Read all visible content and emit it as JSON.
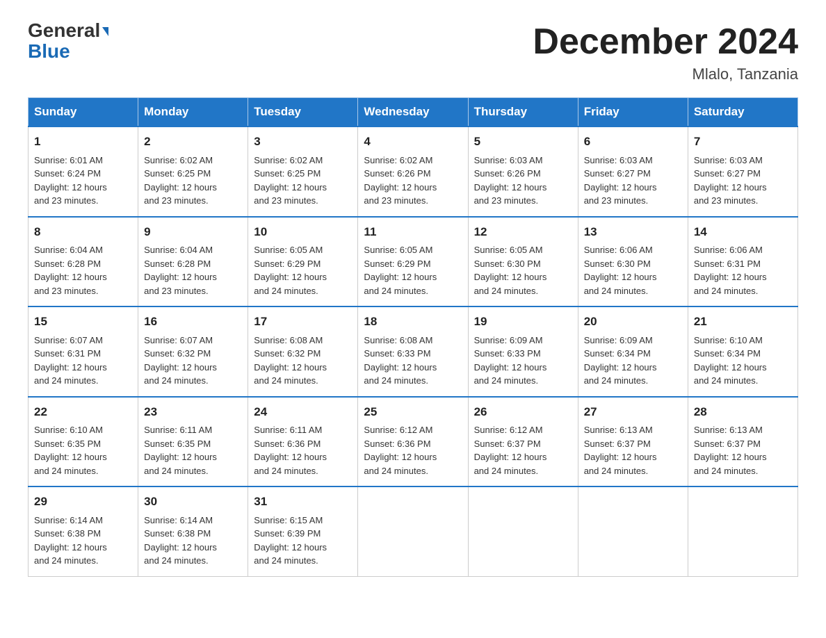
{
  "header": {
    "logo_line1": "General",
    "logo_line2": "Blue",
    "month_title": "December 2024",
    "location": "Mlalo, Tanzania"
  },
  "weekdays": [
    "Sunday",
    "Monday",
    "Tuesday",
    "Wednesday",
    "Thursday",
    "Friday",
    "Saturday"
  ],
  "weeks": [
    [
      {
        "day": "1",
        "sunrise": "6:01 AM",
        "sunset": "6:24 PM",
        "daylight": "12 hours and 23 minutes."
      },
      {
        "day": "2",
        "sunrise": "6:02 AM",
        "sunset": "6:25 PM",
        "daylight": "12 hours and 23 minutes."
      },
      {
        "day": "3",
        "sunrise": "6:02 AM",
        "sunset": "6:25 PM",
        "daylight": "12 hours and 23 minutes."
      },
      {
        "day": "4",
        "sunrise": "6:02 AM",
        "sunset": "6:26 PM",
        "daylight": "12 hours and 23 minutes."
      },
      {
        "day": "5",
        "sunrise": "6:03 AM",
        "sunset": "6:26 PM",
        "daylight": "12 hours and 23 minutes."
      },
      {
        "day": "6",
        "sunrise": "6:03 AM",
        "sunset": "6:27 PM",
        "daylight": "12 hours and 23 minutes."
      },
      {
        "day": "7",
        "sunrise": "6:03 AM",
        "sunset": "6:27 PM",
        "daylight": "12 hours and 23 minutes."
      }
    ],
    [
      {
        "day": "8",
        "sunrise": "6:04 AM",
        "sunset": "6:28 PM",
        "daylight": "12 hours and 23 minutes."
      },
      {
        "day": "9",
        "sunrise": "6:04 AM",
        "sunset": "6:28 PM",
        "daylight": "12 hours and 23 minutes."
      },
      {
        "day": "10",
        "sunrise": "6:05 AM",
        "sunset": "6:29 PM",
        "daylight": "12 hours and 24 minutes."
      },
      {
        "day": "11",
        "sunrise": "6:05 AM",
        "sunset": "6:29 PM",
        "daylight": "12 hours and 24 minutes."
      },
      {
        "day": "12",
        "sunrise": "6:05 AM",
        "sunset": "6:30 PM",
        "daylight": "12 hours and 24 minutes."
      },
      {
        "day": "13",
        "sunrise": "6:06 AM",
        "sunset": "6:30 PM",
        "daylight": "12 hours and 24 minutes."
      },
      {
        "day": "14",
        "sunrise": "6:06 AM",
        "sunset": "6:31 PM",
        "daylight": "12 hours and 24 minutes."
      }
    ],
    [
      {
        "day": "15",
        "sunrise": "6:07 AM",
        "sunset": "6:31 PM",
        "daylight": "12 hours and 24 minutes."
      },
      {
        "day": "16",
        "sunrise": "6:07 AM",
        "sunset": "6:32 PM",
        "daylight": "12 hours and 24 minutes."
      },
      {
        "day": "17",
        "sunrise": "6:08 AM",
        "sunset": "6:32 PM",
        "daylight": "12 hours and 24 minutes."
      },
      {
        "day": "18",
        "sunrise": "6:08 AM",
        "sunset": "6:33 PM",
        "daylight": "12 hours and 24 minutes."
      },
      {
        "day": "19",
        "sunrise": "6:09 AM",
        "sunset": "6:33 PM",
        "daylight": "12 hours and 24 minutes."
      },
      {
        "day": "20",
        "sunrise": "6:09 AM",
        "sunset": "6:34 PM",
        "daylight": "12 hours and 24 minutes."
      },
      {
        "day": "21",
        "sunrise": "6:10 AM",
        "sunset": "6:34 PM",
        "daylight": "12 hours and 24 minutes."
      }
    ],
    [
      {
        "day": "22",
        "sunrise": "6:10 AM",
        "sunset": "6:35 PM",
        "daylight": "12 hours and 24 minutes."
      },
      {
        "day": "23",
        "sunrise": "6:11 AM",
        "sunset": "6:35 PM",
        "daylight": "12 hours and 24 minutes."
      },
      {
        "day": "24",
        "sunrise": "6:11 AM",
        "sunset": "6:36 PM",
        "daylight": "12 hours and 24 minutes."
      },
      {
        "day": "25",
        "sunrise": "6:12 AM",
        "sunset": "6:36 PM",
        "daylight": "12 hours and 24 minutes."
      },
      {
        "day": "26",
        "sunrise": "6:12 AM",
        "sunset": "6:37 PM",
        "daylight": "12 hours and 24 minutes."
      },
      {
        "day": "27",
        "sunrise": "6:13 AM",
        "sunset": "6:37 PM",
        "daylight": "12 hours and 24 minutes."
      },
      {
        "day": "28",
        "sunrise": "6:13 AM",
        "sunset": "6:37 PM",
        "daylight": "12 hours and 24 minutes."
      }
    ],
    [
      {
        "day": "29",
        "sunrise": "6:14 AM",
        "sunset": "6:38 PM",
        "daylight": "12 hours and 24 minutes."
      },
      {
        "day": "30",
        "sunrise": "6:14 AM",
        "sunset": "6:38 PM",
        "daylight": "12 hours and 24 minutes."
      },
      {
        "day": "31",
        "sunrise": "6:15 AM",
        "sunset": "6:39 PM",
        "daylight": "12 hours and 24 minutes."
      },
      null,
      null,
      null,
      null
    ]
  ]
}
